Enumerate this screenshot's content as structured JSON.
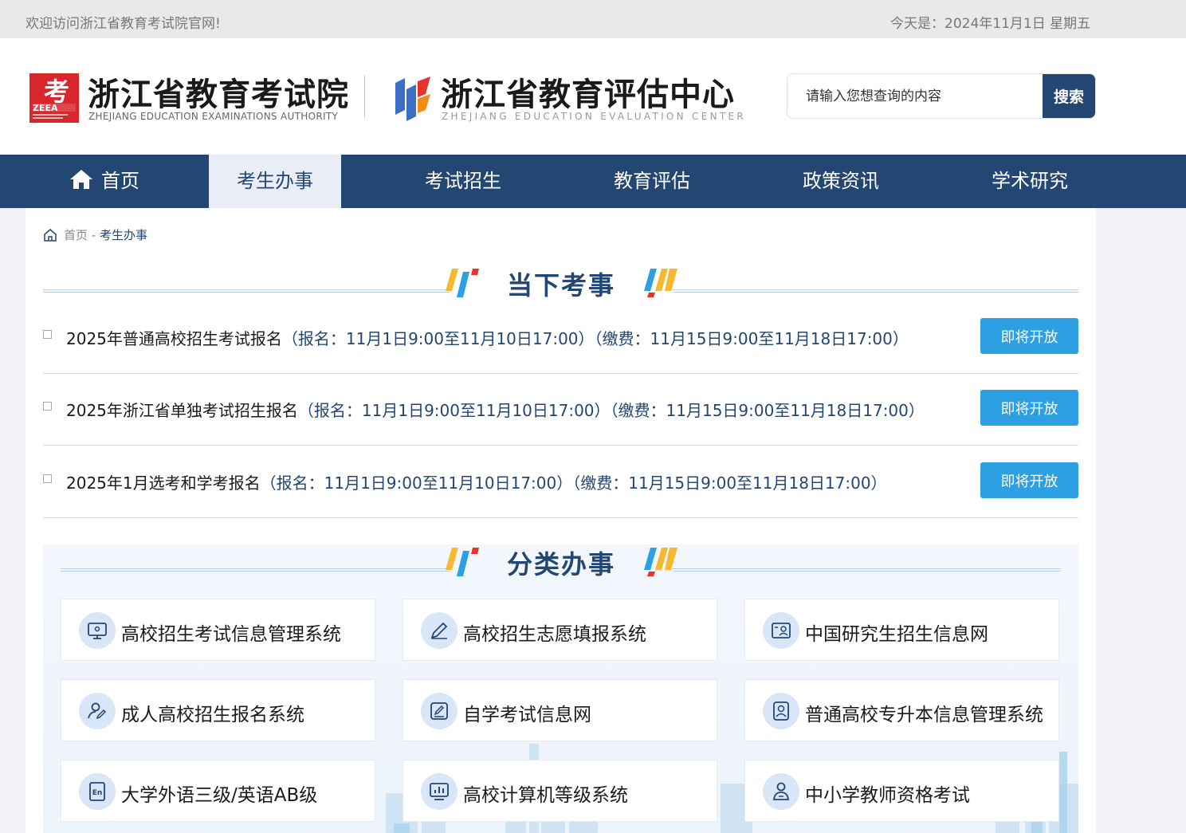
{
  "topbar": {
    "welcome": "欢迎访问浙江省教育考试院官网!",
    "date": "今天是：2024年11月1日 星期五"
  },
  "header": {
    "logo1": {
      "mark_text": "考",
      "mark_abbr": "ZEEA",
      "name_cn": "浙江省教育考试院",
      "name_en": "ZHEJIANG EDUCATION EXAMINATIONS AUTHORITY"
    },
    "logo2": {
      "name_cn": "浙江省教育评估中心",
      "name_en": "ZHEJIANG EDUCATION EVALUATION CENTER"
    },
    "search": {
      "placeholder": "请输入您想查询的内容",
      "button": "搜索"
    }
  },
  "nav": {
    "items": [
      {
        "label": "首页",
        "active": false
      },
      {
        "label": "考生办事",
        "active": true
      },
      {
        "label": "考试招生",
        "active": false
      },
      {
        "label": "教育评估",
        "active": false
      },
      {
        "label": "政策资讯",
        "active": false
      },
      {
        "label": "学术研究",
        "active": false
      }
    ]
  },
  "breadcrumb": {
    "home": "首页",
    "separator": " - ",
    "current": "考生办事"
  },
  "current_exams": {
    "title": "当下考事",
    "items": [
      {
        "name": "2025年普通高校招生考试报名",
        "register": "（报名：11月1日9:00至11月10日17:00）",
        "payment": "（缴费：11月15日9:00至11月18日17:00）",
        "button": "即将开放"
      },
      {
        "name": "2025年浙江省单独考试招生报名",
        "register": "（报名：11月1日9:00至11月10日17:00）",
        "payment": "（缴费：11月15日9:00至11月18日17:00）",
        "button": "即将开放"
      },
      {
        "name": "2025年1月选考和学考报名",
        "register": "（报名：11月1日9:00至11月10日17:00）",
        "payment": "（缴费：11月15日9:00至11月18日17:00）",
        "button": "即将开放"
      }
    ]
  },
  "categories": {
    "title": "分类办事",
    "items": [
      {
        "label": "高校招生考试信息管理系统",
        "icon": "monitor-icon"
      },
      {
        "label": "高校招生志愿填报系统",
        "icon": "pen-icon"
      },
      {
        "label": "中国研究生招生信息网",
        "icon": "student-card-icon"
      },
      {
        "label": "成人高校招生报名系统",
        "icon": "user-edit-icon"
      },
      {
        "label": "自学考试信息网",
        "icon": "edit-doc-icon"
      },
      {
        "label": "普通高校专升本信息管理系统",
        "icon": "id-badge-icon"
      },
      {
        "label": "大学外语三级/英语AB级",
        "icon": "english-doc-icon"
      },
      {
        "label": "高校计算机等级系统",
        "icon": "computer-chart-icon"
      },
      {
        "label": "中小学教师资格考试",
        "icon": "teacher-icon"
      }
    ]
  },
  "colors": {
    "nav_bg": "#234673",
    "nav_active_bg": "#e9eef6",
    "accent_blue": "#2d9fe3",
    "title_blue": "#234673",
    "logo_red": "#d9262c"
  }
}
